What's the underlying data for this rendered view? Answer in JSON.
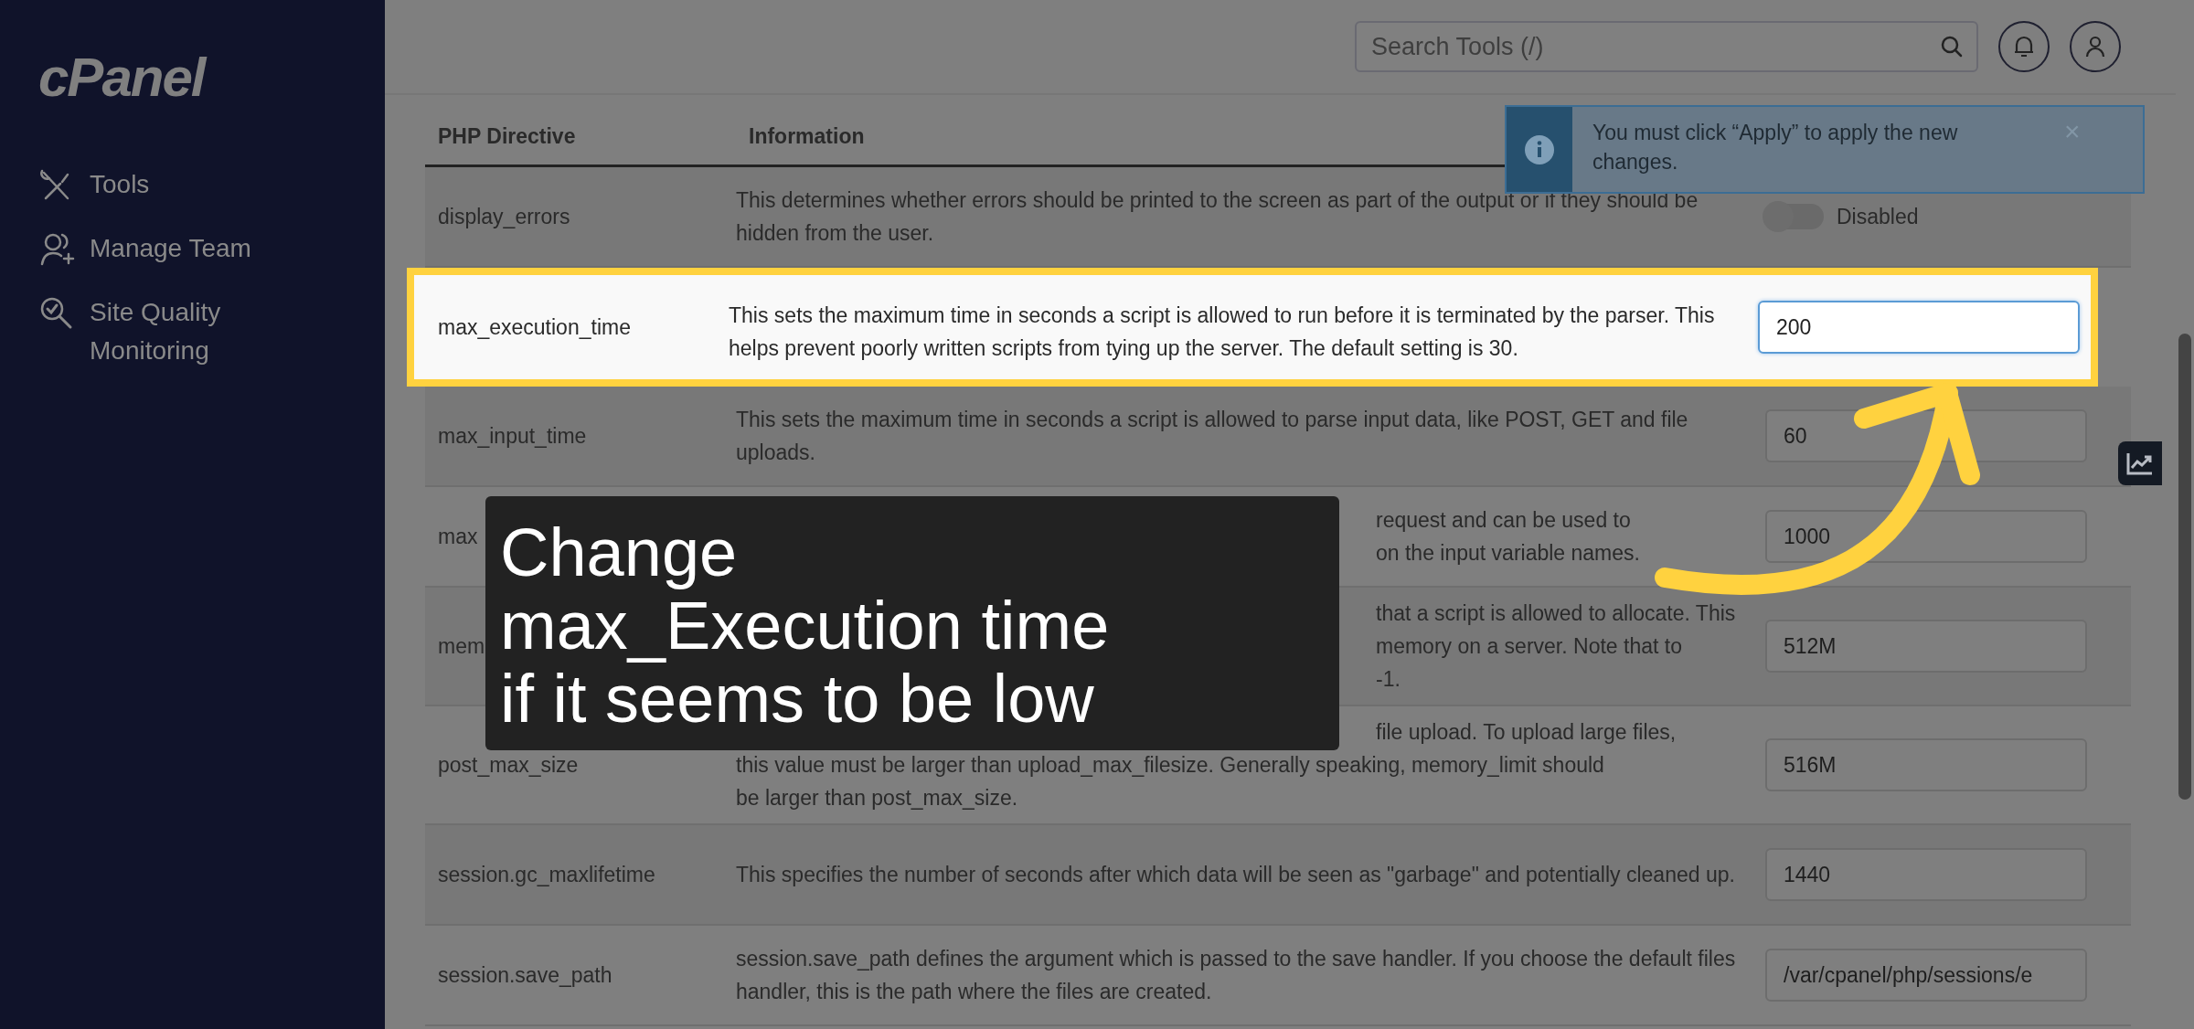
{
  "sidebar": {
    "logo": "cPanel",
    "items": [
      {
        "label": "Tools",
        "kind": "tools"
      },
      {
        "label": "Manage Team",
        "kind": "team"
      },
      {
        "label": "Site Quality Monitoring",
        "kind": "quality"
      }
    ]
  },
  "topbar": {
    "search": {
      "placeholder": "Search Tools (/)"
    }
  },
  "notice": {
    "text": "You must click “Apply” to apply the new changes.",
    "close": "×"
  },
  "table": {
    "columns": [
      "PHP Directive",
      "Information"
    ],
    "rows": [
      {
        "directive": "display_errors",
        "info": "This determines whether errors should be printed to the screen as part of the output or if they should be hidden from the user.",
        "kind": "toggle",
        "on": false,
        "value": "Disabled",
        "highlighted": false
      },
      {
        "directive": "max_execution_time",
        "info": "This sets the maximum time in seconds a script is allowed to run before it is terminated by the parser. This helps prevent poorly written scripts from tying up the server. The default setting is 30.",
        "kind": "input",
        "value": "200",
        "highlighted": true
      },
      {
        "directive": "max_input_time",
        "info": "This sets the maximum time in seconds a script is allowed to parse input data, like POST, GET and file uploads.",
        "kind": "input",
        "value": "60",
        "highlighted": false
      },
      {
        "directive": "max",
        "info_lines": [
          {
            "text": "request and can be used to",
            "clipped": true
          },
          {
            "text": "on the input variable names.",
            "clipped": true
          }
        ],
        "kind": "input",
        "value": "1000",
        "highlighted": false
      },
      {
        "directive": "mem",
        "info_lines": [
          {
            "text": "that a script is allowed to allocate. This",
            "clipped": true
          },
          {
            "text": "memory on a server. Note that to",
            "clipped": true
          },
          {
            "text": "-1.",
            "clipped": true
          }
        ],
        "kind": "input",
        "value": "512M",
        "highlighted": false
      },
      {
        "directive": "post_max_size",
        "info_lines": [
          {
            "text": "file upload. To upload large files,",
            "clipped": true
          },
          {
            "text": "this value must be larger than upload_max_filesize. Generally speaking, memory_limit should"
          },
          {
            "text": "be larger than post_max_size."
          }
        ],
        "kind": "input",
        "value": "516M",
        "highlighted": false
      },
      {
        "directive": "session.gc_maxlifetime",
        "info": "This specifies the number of seconds after which data will be seen as \"garbage\" and potentially cleaned up.",
        "kind": "input",
        "value": "1440",
        "highlighted": false
      },
      {
        "directive": "session.save_path",
        "info": "session.save_path defines the argument which is passed to the save handler. If you choose the default files handler, this is the path where the files are created.",
        "kind": "input",
        "value": "/var/cpanel/php/sessions/e",
        "highlighted": false
      }
    ]
  },
  "caption": {
    "lines": [
      "Change",
      "max_Execution time",
      "if it seems to be low"
    ]
  }
}
